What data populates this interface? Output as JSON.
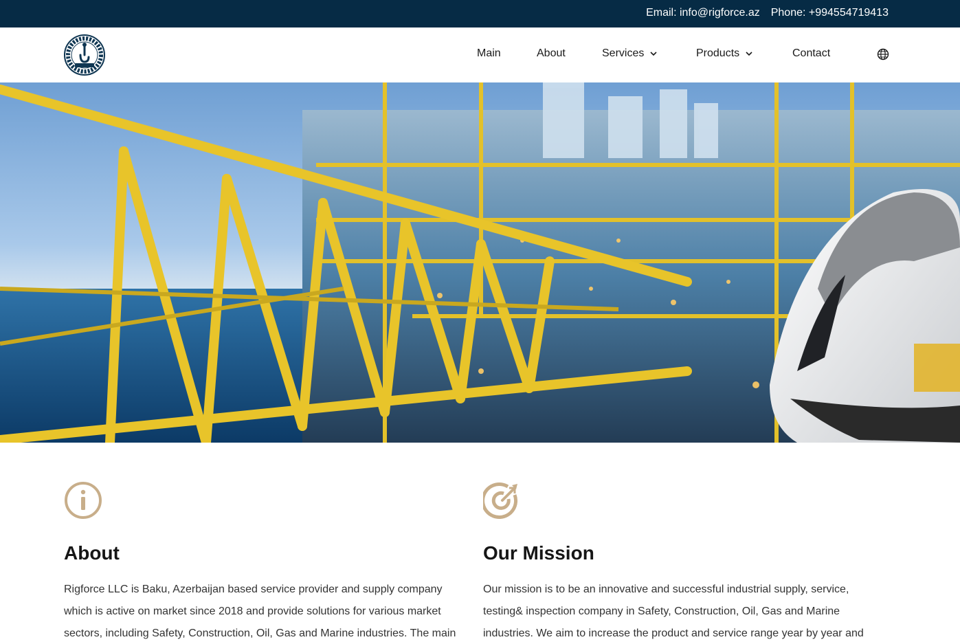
{
  "topbar": {
    "email": "Email: info@rigforce.az",
    "phone": "Phone: +994554719413"
  },
  "header": {
    "logo_text": "RIGFORCE",
    "nav": [
      {
        "label": "Main",
        "has_dropdown": false
      },
      {
        "label": "About",
        "has_dropdown": false
      },
      {
        "label": "Services",
        "has_dropdown": true
      },
      {
        "label": "Products",
        "has_dropdown": true
      },
      {
        "label": "Contact",
        "has_dropdown": false
      }
    ],
    "language_icon": "globe-icon"
  },
  "hero": {
    "image": "offshore-oil-platform-with-worker-helmet"
  },
  "about": {
    "icon": "info-icon",
    "title": "About",
    "text": "Rigforce LLC is Baku, Azerbaijan based service provider and supply company which is active on market since 2018 and provide solutions for various market sectors, including Safety, Construction, Oil, Gas and Marine industries. The main service"
  },
  "mission": {
    "icon": "target-icon",
    "title": "Our Mission",
    "text": "Our mission is to be an innovative and successful industrial supply, service, testing& inspection company in Safety, Construction, Oil, Gas and Marine industries. We aim to increase the product and service range year by year and"
  },
  "colors": {
    "topbar_bg": "#062b45",
    "accent": "#c8ae8a",
    "nav_text": "#1a1a1a"
  }
}
